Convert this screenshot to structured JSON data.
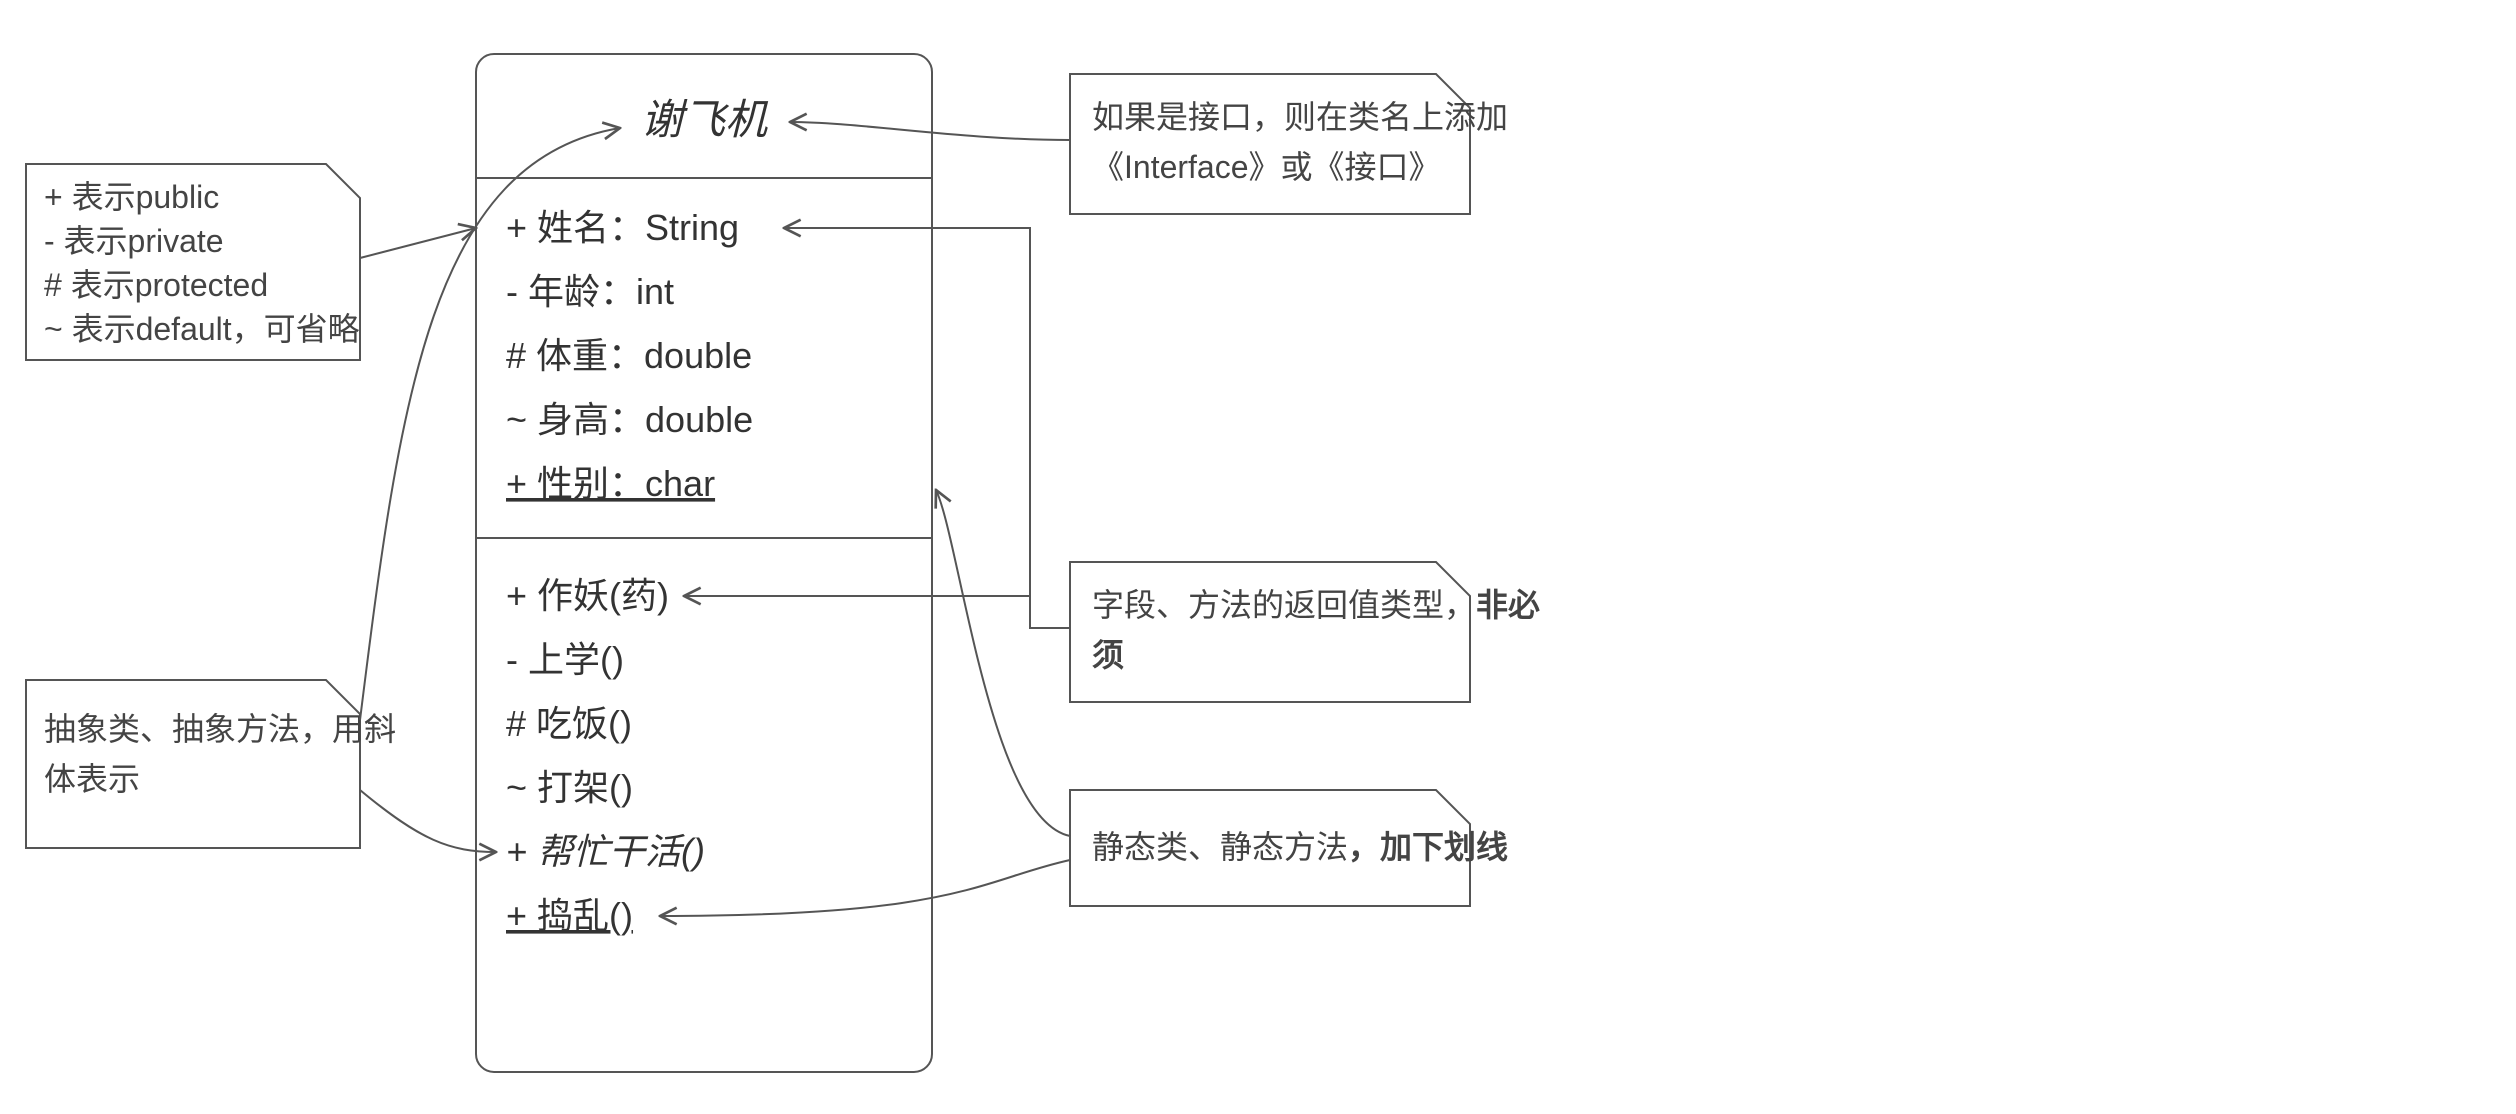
{
  "uml": {
    "class_name": "谢飞机",
    "fields": [
      {
        "text": "+ 姓名：String",
        "italic": false,
        "underline": false
      },
      {
        "text": "- 年龄：int",
        "italic": false,
        "underline": false
      },
      {
        "text": "# 体重：double",
        "italic": false,
        "underline": false
      },
      {
        "text": "~ 身高：double",
        "italic": false,
        "underline": false
      },
      {
        "text": "+ 性别：char",
        "italic": false,
        "underline": true
      }
    ],
    "methods": [
      {
        "text": "+ 作妖(药)",
        "italic": false,
        "underline": false
      },
      {
        "text": "- 上学()",
        "italic": false,
        "underline": false
      },
      {
        "text": "# 吃饭()",
        "italic": false,
        "underline": false
      },
      {
        "text": "~ 打架()",
        "italic": false,
        "underline": false
      },
      {
        "text": "+ 帮忙干活()",
        "italic": true,
        "underline": false
      },
      {
        "text": "+ 捣乱()",
        "italic": false,
        "underline": true
      }
    ]
  },
  "notes": {
    "visibility": {
      "l1": "+ 表示public",
      "l2": "- 表示private",
      "l3": "# 表示protected",
      "l4": "~ 表示default，可省略"
    },
    "abstract": {
      "l1": "抽象类、抽象方法，用斜",
      "l2": "体表示"
    },
    "interface": {
      "l1": "如果是接口，则在类名上添加",
      "l2": "《Interface》或《接口》"
    },
    "return_type": {
      "l1_a": "字段、方法的返回值类型，",
      "l1_b": "非必",
      "l2": "须"
    },
    "static": {
      "l1_a": "静态类、静态方法",
      "l1_b": "，加下划线"
    }
  }
}
